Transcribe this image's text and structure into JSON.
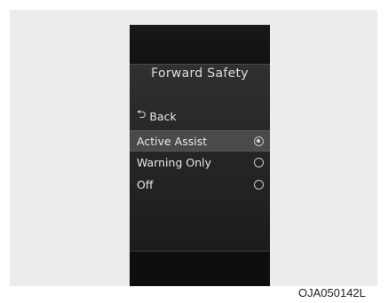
{
  "screen": {
    "title": "Forward Safety",
    "back": {
      "icon": "back-arrow-icon",
      "glyph": "⮌",
      "label": "Back"
    },
    "options": [
      {
        "label": "Active Assist",
        "selected": true
      },
      {
        "label": "Warning Only",
        "selected": false
      },
      {
        "label": "Off",
        "selected": false
      }
    ]
  },
  "figure_code": "OJA050142L"
}
